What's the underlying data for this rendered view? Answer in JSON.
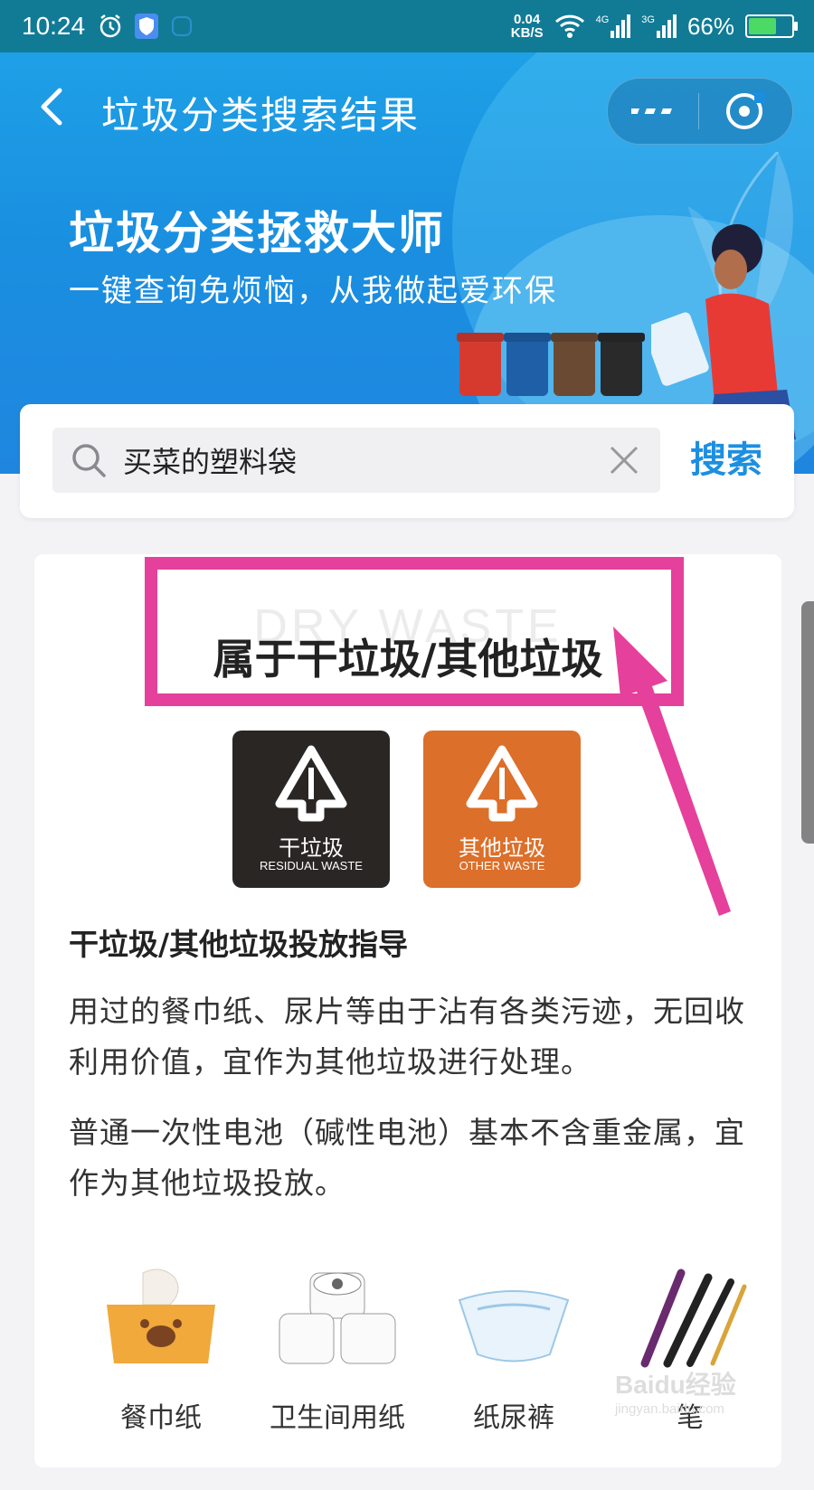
{
  "status_bar": {
    "time": "10:24",
    "speed_value": "0.04",
    "speed_unit": "KB/S",
    "network_4g": "4G",
    "network_3g": "3G",
    "battery_percent": "66%",
    "battery_level": 0.66
  },
  "navbar": {
    "title": "垃圾分类搜索结果"
  },
  "banner": {
    "title": "垃圾分类拯救大师",
    "subtitle": "一键查询免烦恼，从我做起爱环保"
  },
  "search": {
    "value": "买菜的塑料袋",
    "button_label": "搜索"
  },
  "result": {
    "watermark": "DRY WASTE",
    "title": "属于干垃圾/其他垃圾",
    "tiles": [
      {
        "cn": "干垃圾",
        "en": "RESIDUAL WASTE"
      },
      {
        "cn": "其他垃圾",
        "en": "OTHER WASTE"
      }
    ],
    "guide_title": "干垃圾/其他垃圾投放指导",
    "paragraphs": [
      "用过的餐巾纸、尿片等由于沾有各类污迹，无回收利用价值，宜作为其他垃圾进行处理。",
      "普通一次性电池（碱性电池）基本不含重金属，宜作为其他垃圾投放。"
    ],
    "examples": [
      "餐巾纸",
      "卫生间用纸",
      "纸尿裤",
      "笔"
    ]
  },
  "watermark_site": {
    "brand": "Baidu经验",
    "url": "jingyan.baidu.com"
  },
  "colors": {
    "status_bar": "#117b96",
    "banner": "#1a8fe0",
    "accent": "#1d8fe0",
    "highlight": "#e5409b",
    "dry_tile": "#2a2624",
    "other_tile": "#dc6f2a"
  }
}
